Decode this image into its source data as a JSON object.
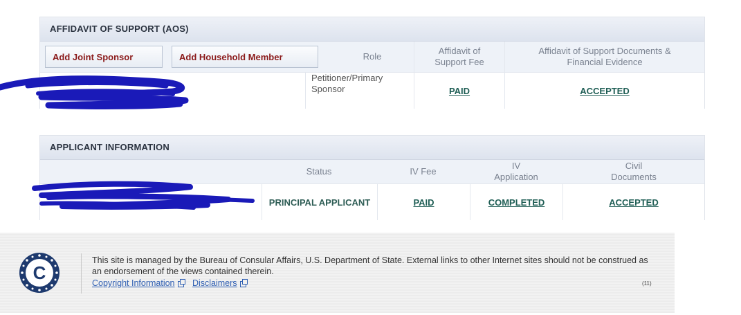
{
  "aos": {
    "title": "AFFIDAVIT OF SUPPORT (AOS)",
    "add_joint_sponsor": "Add Joint Sponsor",
    "add_household_member": "Add Household Member",
    "col_role": "Role",
    "col_fee_line1": "Affidavit of",
    "col_fee_line2": "Support Fee",
    "col_docs_line1": "Affidavit of Support Documents &",
    "col_docs_line2": "Financial Evidence",
    "row": {
      "role_line1": "Petitioner/Primary",
      "role_line2": "Sponsor",
      "fee": "PAID",
      "docs": "ACCEPTED"
    }
  },
  "applicant": {
    "title": "APPLICANT INFORMATION",
    "col_status": "Status",
    "col_iv_fee": "IV Fee",
    "col_iv_app_line1": "IV",
    "col_iv_app_line2": "Application",
    "col_civil_line1": "Civil",
    "col_civil_line2": "Documents",
    "row": {
      "status": "PRINCIPAL APPLICANT",
      "iv_fee": "PAID",
      "iv_application": "COMPLETED",
      "civil_documents": "ACCEPTED"
    }
  },
  "footer": {
    "text": "This site is managed by the Bureau of Consular Affairs, U.S. Department of State. External links to other Internet sites should not be construed as an endorsement of the views contained therein.",
    "copyright_link": "Copyright Information",
    "disclaimers_link": "Disclaimers",
    "page_code": "(11)",
    "logo_letter": "C"
  },
  "colors": {
    "link": "#1f5e55",
    "button_text": "#8b1a1a",
    "header_bg": "#eef2f8",
    "logo": "#1e3a6e"
  }
}
